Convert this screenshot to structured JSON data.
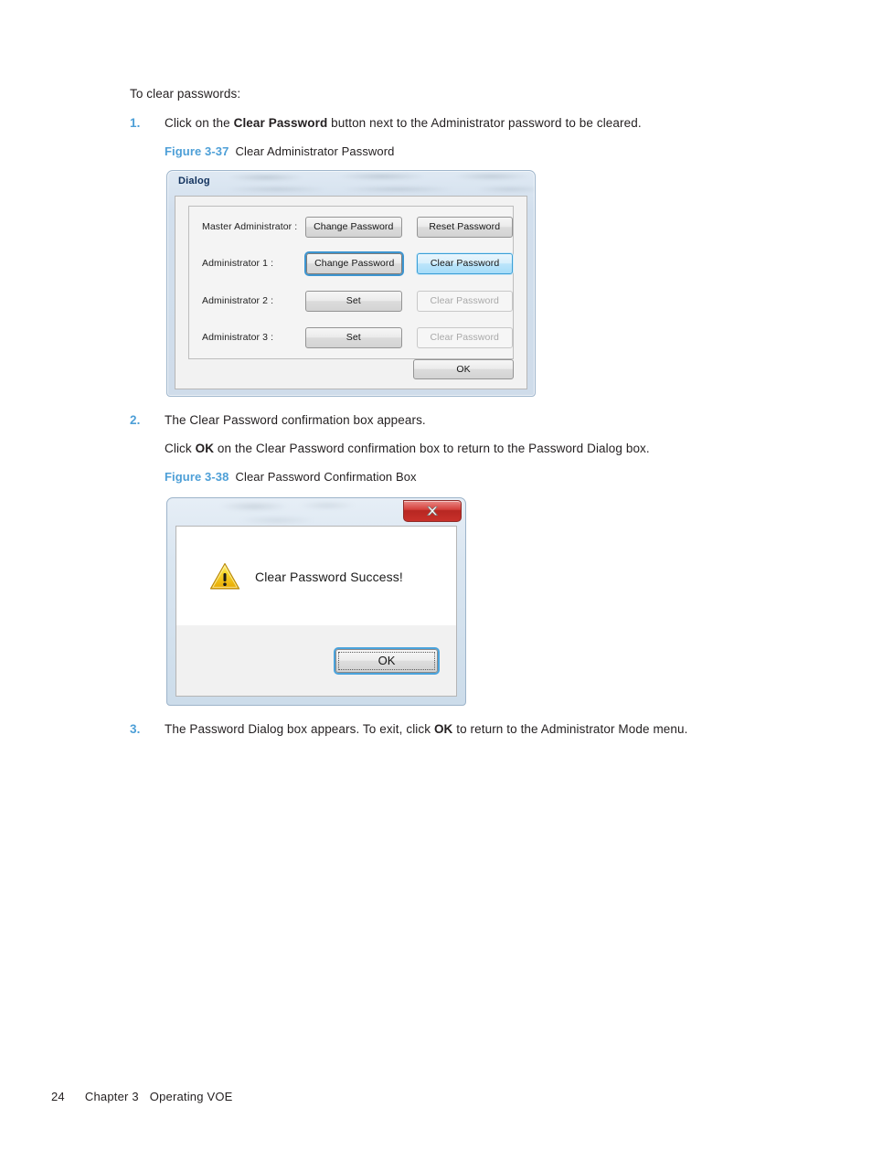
{
  "page": {
    "intro": "To clear passwords:",
    "footer": {
      "page_number": "24",
      "chapter": "Chapter 3",
      "chapter_title": "Operating VOE"
    }
  },
  "steps": [
    {
      "number": "1.",
      "text_before": "Click on the ",
      "bold": "Clear Password",
      "text_after": " button next to the Administrator password to be cleared."
    },
    {
      "number": "2.",
      "text_before": "The Clear Password confirmation box appears.",
      "bold": "",
      "text_after": ""
    },
    {
      "number": "3.",
      "text_before": "The Password Dialog box appears. To exit, click ",
      "bold": "OK",
      "text_after": " to return to the Administrator Mode menu."
    }
  ],
  "step2_subline": {
    "text_before": "Click ",
    "bold": "OK",
    "text_after": " on the Clear Password confirmation box to return to the Password Dialog box."
  },
  "figures": [
    {
      "number": "Figure 3-37",
      "caption": "Clear Administrator Password"
    },
    {
      "number": "Figure 3-38",
      "caption": "Clear Password Confirmation Box"
    }
  ],
  "password_dialog": {
    "title": "Dialog",
    "rows": [
      {
        "label": "Master Administrator :",
        "primary_button": "Change Password",
        "secondary_button": "Reset Password",
        "primary_state": "normal",
        "secondary_state": "normal"
      },
      {
        "label": "Administrator 1 :",
        "primary_button": "Change Password",
        "secondary_button": "Clear Password",
        "primary_state": "focused",
        "secondary_state": "highlighted"
      },
      {
        "label": "Administrator 2 :",
        "primary_button": "Set",
        "secondary_button": "Clear Password",
        "primary_state": "normal",
        "secondary_state": "disabled"
      },
      {
        "label": "Administrator 3 :",
        "primary_button": "Set",
        "secondary_button": "Clear Password",
        "primary_state": "normal",
        "secondary_state": "disabled"
      }
    ],
    "ok_button": "OK"
  },
  "confirmation_dialog": {
    "title": "",
    "close_button": "✕",
    "icon": "warning-triangle-icon",
    "message": "Clear Password Success!",
    "ok_button": "OK"
  },
  "colors": {
    "accent_blue": "#4d9fd7",
    "text": "#231f20",
    "close_red": "#c8302a",
    "warning_yellow": "#f2c200",
    "focus_blue": "#4aa3dc"
  }
}
